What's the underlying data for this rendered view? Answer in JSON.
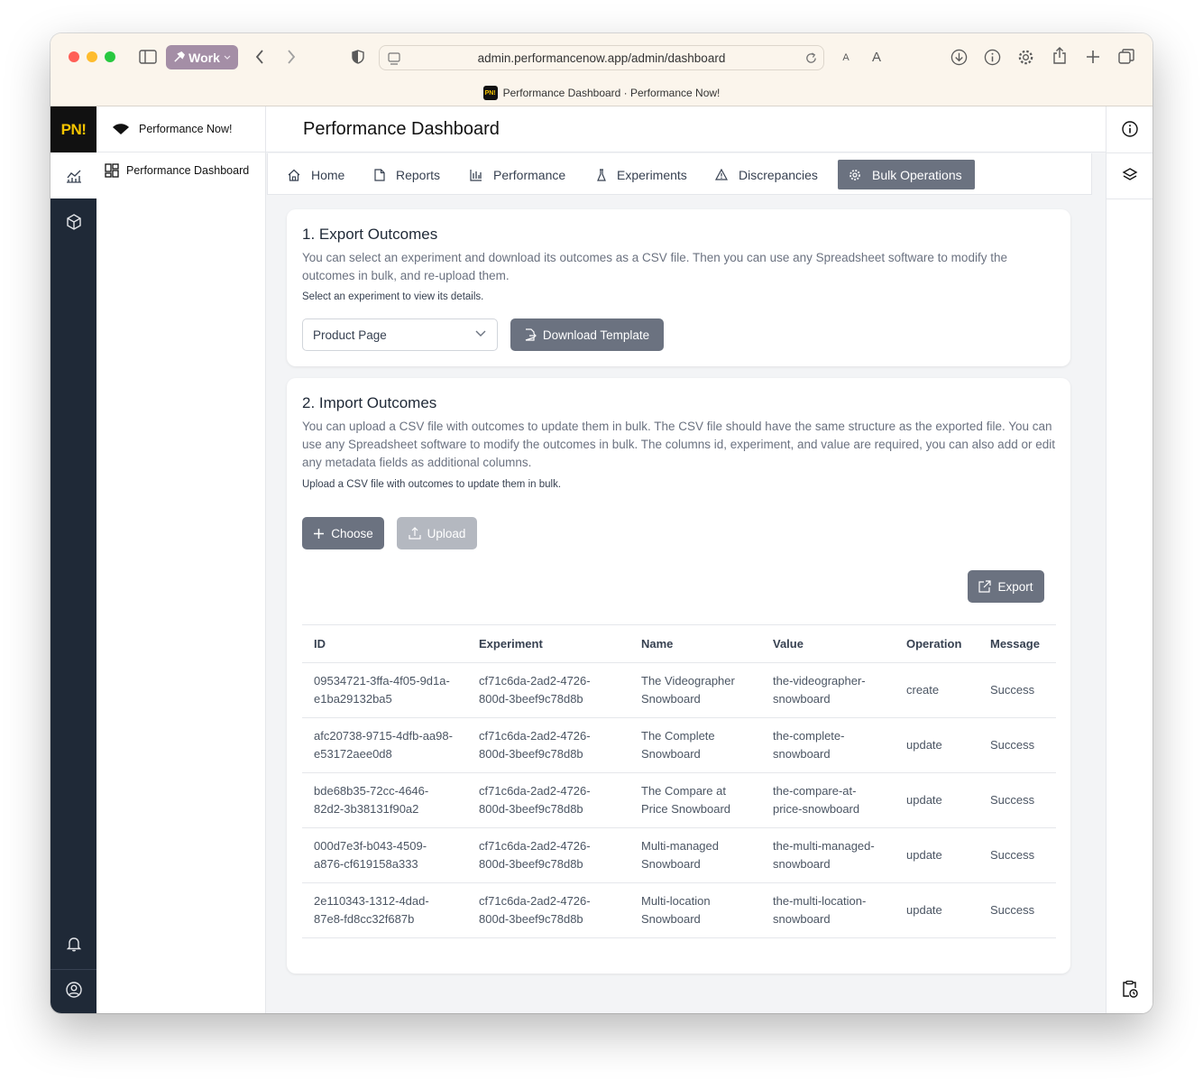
{
  "browser": {
    "profile": "Work",
    "url": "admin.performancenow.app/admin/dashboard",
    "tab_title": "Performance Dashboard · Performance Now!",
    "favicon_text": "PN!",
    "font_small": "A",
    "font_large": "A"
  },
  "rail": {
    "logo": "PN!"
  },
  "sidenav": {
    "brand": "Performance Now!",
    "items": [
      {
        "label": "Performance Dashboard"
      }
    ]
  },
  "page": {
    "title": "Performance Dashboard"
  },
  "tabs": [
    {
      "label": "Home",
      "icon": "home-icon"
    },
    {
      "label": "Reports",
      "icon": "file-icon"
    },
    {
      "label": "Performance",
      "icon": "bar-chart-icon"
    },
    {
      "label": "Experiments",
      "icon": "flask-icon"
    },
    {
      "label": "Discrepancies",
      "icon": "warning-icon"
    },
    {
      "label": "Bulk Operations",
      "icon": "gear-icon",
      "active": true
    }
  ],
  "export_section": {
    "title": "1. Export Outcomes",
    "description": "You can select an experiment and download its outcomes as a CSV file. Then you can use any Spreadsheet software to modify the outcomes in bulk, and re-upload them.",
    "hint": "Select an experiment to view its details.",
    "selected_experiment": "Product Page",
    "download_label": "Download Template"
  },
  "import_section": {
    "title": "2. Import Outcomes",
    "description": "You can upload a CSV file with outcomes to update them in bulk. The CSV file should have the same structure as the exported file. You can use any Spreadsheet software to modify the outcomes in bulk. The columns id, experiment, and value are required, you can also add or edit any metadata fields as additional columns.",
    "hint": "Upload a CSV file with outcomes to update them in bulk.",
    "choose_label": "Choose",
    "upload_label": "Upload",
    "export_label": "Export"
  },
  "table": {
    "headers": [
      "ID",
      "Experiment",
      "Name",
      "Value",
      "Operation",
      "Message"
    ],
    "rows": [
      [
        "09534721-3ffa-4f05-9d1a-e1ba29132ba5",
        "cf71c6da-2ad2-4726-800d-3beef9c78d8b",
        "The Videographer Snowboard",
        "the-videographer-snowboard",
        "create",
        "Success"
      ],
      [
        "afc20738-9715-4dfb-aa98-e53172aee0d8",
        "cf71c6da-2ad2-4726-800d-3beef9c78d8b",
        "The Complete Snowboard",
        "the-complete-snowboard",
        "update",
        "Success"
      ],
      [
        "bde68b35-72cc-4646-82d2-3b38131f90a2",
        "cf71c6da-2ad2-4726-800d-3beef9c78d8b",
        "The Compare at Price Snowboard",
        "the-compare-at-price-snowboard",
        "update",
        "Success"
      ],
      [
        "000d7e3f-b043-4509-a876-cf619158a333",
        "cf71c6da-2ad2-4726-800d-3beef9c78d8b",
        "Multi-managed Snowboard",
        "the-multi-managed-snowboard",
        "update",
        "Success"
      ],
      [
        "2e110343-1312-4dad-87e8-fd8cc32f687b",
        "cf71c6da-2ad2-4726-800d-3beef9c78d8b",
        "Multi-location Snowboard",
        "the-multi-location-snowboard",
        "update",
        "Success"
      ]
    ]
  },
  "colors": {
    "brand_yellow": "#f5c400",
    "rail_dark": "#1f2937",
    "active_tab": "#6b7280",
    "button": "#6b7280"
  }
}
